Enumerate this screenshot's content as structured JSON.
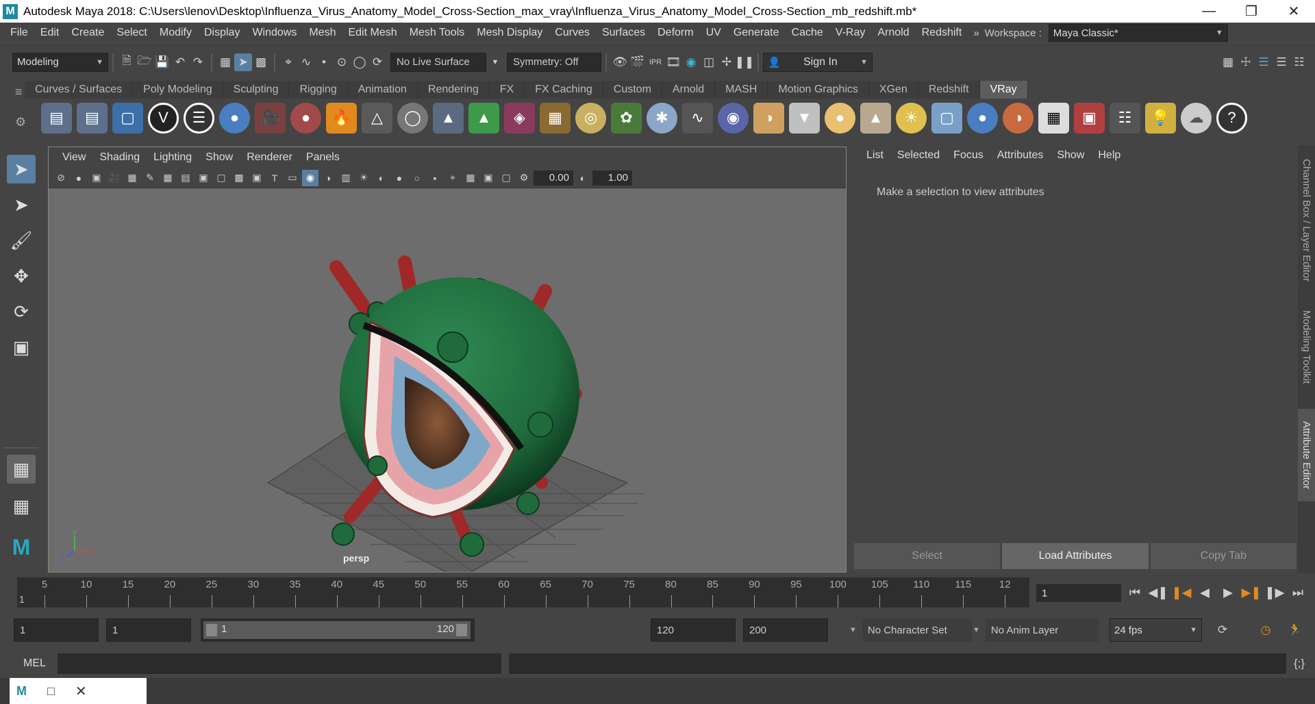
{
  "window": {
    "title": "Autodesk Maya 2018: C:\\Users\\lenov\\Desktop\\Influenza_Virus_Anatomy_Model_Cross-Section_max_vray\\Influenza_Virus_Anatomy_Model_Cross-Section_mb_redshift.mb*"
  },
  "menubar": {
    "items": [
      "File",
      "Edit",
      "Create",
      "Select",
      "Modify",
      "Display",
      "Windows",
      "Mesh",
      "Edit Mesh",
      "Mesh Tools",
      "Mesh Display",
      "Curves",
      "Surfaces",
      "Deform",
      "UV",
      "Generate",
      "Cache",
      "V-Ray",
      "Arnold",
      "Redshift"
    ],
    "workspace_label": "Workspace :",
    "workspace_value": "Maya Classic*"
  },
  "statusline": {
    "menuset": "Modeling",
    "live_surface": "No Live Surface",
    "symmetry": "Symmetry: Off",
    "sign_in": "Sign In"
  },
  "shelf": {
    "tabs": [
      "Curves / Surfaces",
      "Poly Modeling",
      "Sculpting",
      "Rigging",
      "Animation",
      "Rendering",
      "FX",
      "FX Caching",
      "Custom",
      "Arnold",
      "MASH",
      "Motion Graphics",
      "XGen",
      "Redshift",
      "VRay"
    ],
    "active_tab": "VRay"
  },
  "viewport": {
    "menu": [
      "View",
      "Shading",
      "Lighting",
      "Show",
      "Renderer",
      "Panels"
    ],
    "exposure": "0.00",
    "gamma": "1.00",
    "camera_label": "persp"
  },
  "attribute_editor": {
    "menu": [
      "List",
      "Selected",
      "Focus",
      "Attributes",
      "Show",
      "Help"
    ],
    "message": "Make a selection to view attributes",
    "buttons": [
      "Select",
      "Load Attributes",
      "Copy Tab"
    ]
  },
  "side_tabs": [
    "Channel Box / Layer Editor",
    "Modeling Toolkit",
    "Attribute Editor"
  ],
  "timeline": {
    "ticks": [
      "5",
      "10",
      "15",
      "20",
      "25",
      "30",
      "35",
      "40",
      "45",
      "50",
      "55",
      "60",
      "65",
      "70",
      "75",
      "80",
      "85",
      "90",
      "95",
      "100",
      "105",
      "110",
      "115",
      "12"
    ],
    "start_marker": "1",
    "current_frame": "1"
  },
  "range": {
    "start": "1",
    "playback_start": "1",
    "slider_start": "1",
    "slider_end": "120",
    "playback_end": "120",
    "end": "200",
    "character_set": "No Character Set",
    "anim_layer": "No Anim Layer",
    "fps": "24 fps"
  },
  "command_line": {
    "language": "MEL"
  },
  "colors": {
    "virus_shell": "#1f6b3c",
    "spike_red": "#a12828",
    "cross_section_pink": "#e7a4a8",
    "core_blue": "#7fa8c8"
  }
}
